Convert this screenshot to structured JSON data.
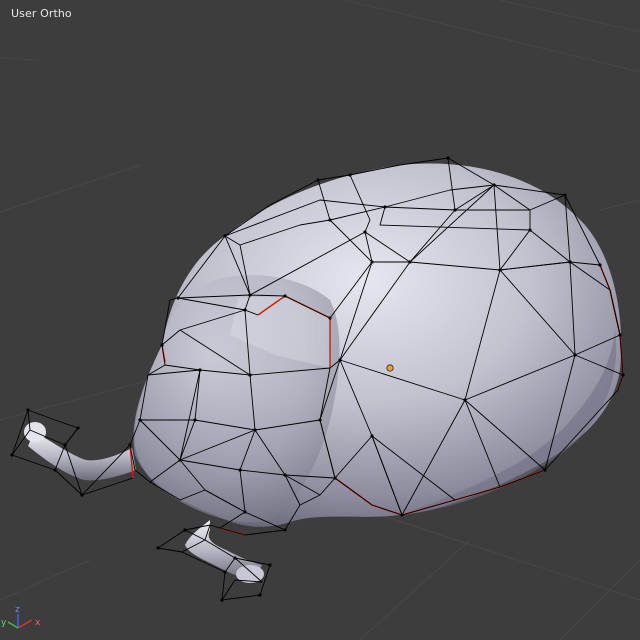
{
  "viewport": {
    "view_label": "User Ortho",
    "background_color": "#3d3d3d",
    "grid_color": "#464646"
  },
  "scene": {
    "object": "mesh-with-wireframe-cage",
    "cage_edge_color": "#000000",
    "seam_edge_color": "#cc2200",
    "origin_color": "#f0a030"
  },
  "axis_gizmo": {
    "x_label": "x",
    "y_label": "y",
    "z_label": "z",
    "x_color": "#e03030",
    "y_color": "#40c040",
    "z_color": "#4060ff"
  }
}
